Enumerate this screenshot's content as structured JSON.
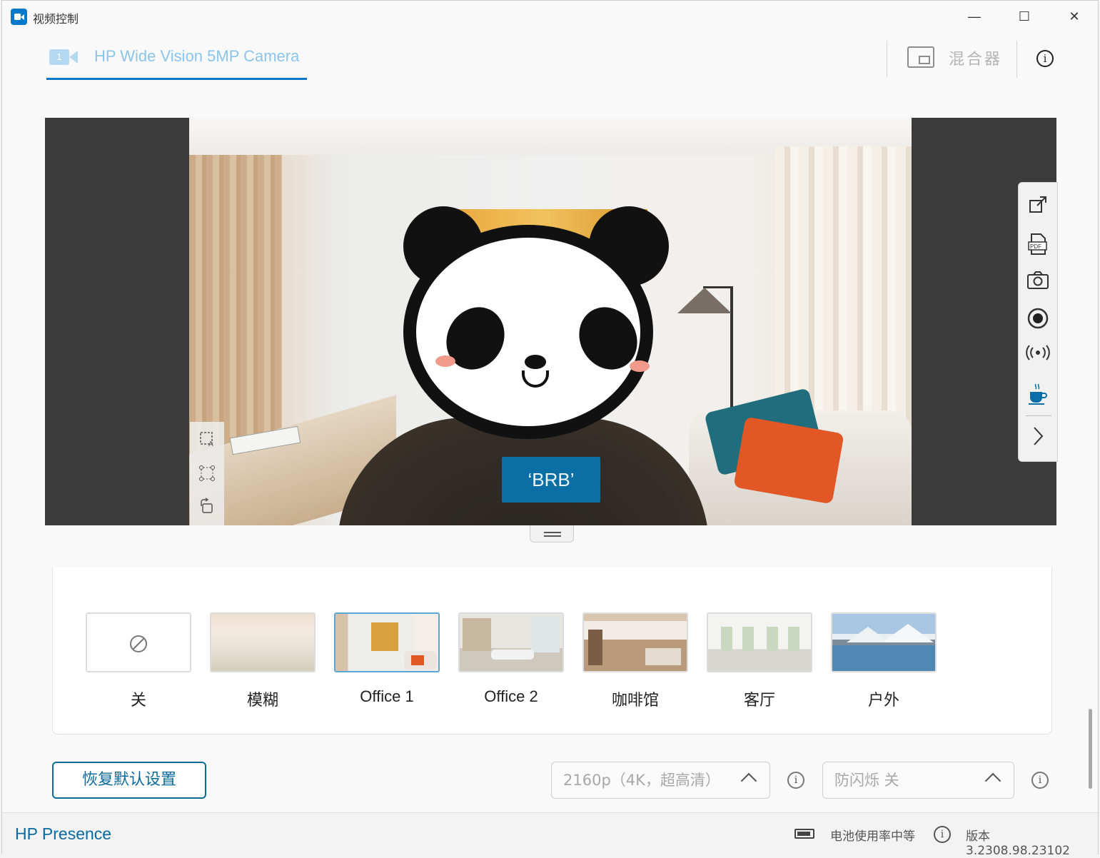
{
  "window": {
    "title": "视频控制",
    "controls": [
      "—",
      "☐",
      "✕"
    ]
  },
  "camera_tab": {
    "label": "HP Wide Vision 5MP Camera",
    "badge": "1"
  },
  "mixer": {
    "label": "混合器"
  },
  "info_symbol": "i",
  "preview": {
    "overlay_label": "‘BRB’"
  },
  "right_toolbar": {
    "items": [
      "popout-icon",
      "pdf-icon",
      "camera-capture-icon",
      "record-icon",
      "broadcast-icon",
      "coffee-icon",
      "chevron-right-icon"
    ]
  },
  "backgrounds": {
    "items": [
      {
        "label": "关",
        "kind": "off"
      },
      {
        "label": "模糊",
        "kind": "blur"
      },
      {
        "label": "Office 1",
        "kind": "office1",
        "selected": true
      },
      {
        "label": "Office 2",
        "kind": "office2"
      },
      {
        "label": "咖啡馆",
        "kind": "cafe"
      },
      {
        "label": "客厅",
        "kind": "livingroom"
      },
      {
        "label": "户外",
        "kind": "outdoor"
      }
    ]
  },
  "controls": {
    "restore_label": "恢复默认设置",
    "resolution_value": "2160p（4K，超高清）",
    "antiflicker_value": "防闪烁  关"
  },
  "footer": {
    "brand": "HP Presence",
    "battery_text": "电池使用率中等",
    "version_text": "版本 3.2308.98.23102"
  },
  "colors": {
    "accent": "#0a78c8",
    "brb_bg": "#0b6fa5"
  }
}
